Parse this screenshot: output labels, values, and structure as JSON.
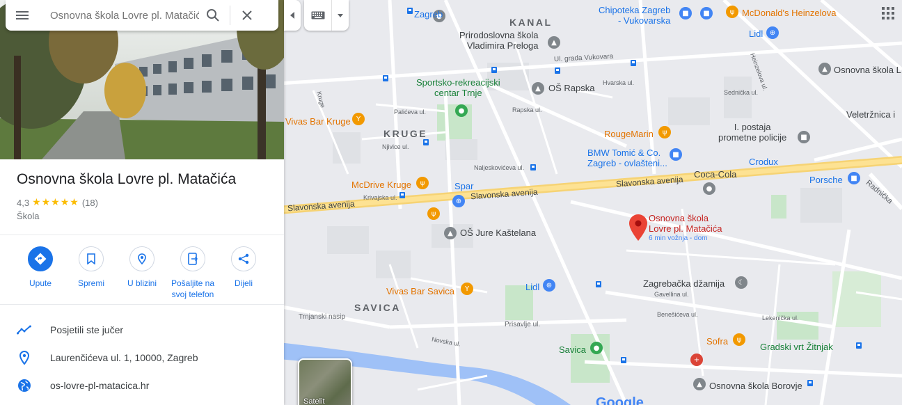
{
  "search": {
    "placeholder": "Osnovna škola Lovre pl. Matačića",
    "value": "Osnovna škola Lovre pl. Matačića"
  },
  "place": {
    "title": "Osnovna škola Lovre pl. Matačića",
    "rating": "4,3",
    "stars": "★★★★★",
    "review_count": "(18)",
    "category": "Škola"
  },
  "actions": [
    {
      "label": "Upute",
      "icon": "directions-icon"
    },
    {
      "label": "Spremi",
      "icon": "bookmark-icon"
    },
    {
      "label": "U blizini",
      "icon": "nearby-icon"
    },
    {
      "label": "Pošaljite na svoj telefon",
      "icon": "send-to-phone-icon"
    },
    {
      "label": "Dijeli",
      "icon": "share-icon"
    }
  ],
  "info": [
    {
      "text": "Posjetili ste jučer",
      "icon": "trend-icon"
    },
    {
      "text": "Laurenčićeva ul. 1, 10000, Zagreb",
      "icon": "location-pin-icon"
    },
    {
      "text": "os-lovre-pl-matacica.hr",
      "icon": "globe-icon"
    }
  ],
  "map": {
    "satellite_label": "Satelit",
    "logo": "Google",
    "marker": {
      "name_line1": "Osnovna škola",
      "name_line2": "Lovre pl. Matačića",
      "eta": "6 min vožnja - dom"
    },
    "districts": [
      "KANAL",
      "KRUGE",
      "SAVICA"
    ],
    "pois": {
      "zagreb": "Zagreb",
      "prirodoslovna1": "Prirodoslovna škola",
      "prirodoslovna2": "Vladimira Preloga",
      "sportsko1": "Sportsko-rekreacijski",
      "sportsko2": "centar Trnje",
      "os_rapska": "OŠ Rapska",
      "vivas_kruge": "Vivas Bar Kruge",
      "mcdrive": "McDrive Kruge",
      "spar": "Spar",
      "os_jure": "OŠ Jure Kaštelana",
      "vivas_savica": "Vivas Bar Savica",
      "lidl1": "Lidl",
      "lidl2": "Lidl",
      "savica": "Savica",
      "chipoteka1": "Chipoteka Zagreb",
      "chipoteka2": "- Vukovarska",
      "mcdonalds": "McDonald's Heinzelova",
      "rougemarin": "RougeMarin",
      "bmw1": "BMW Tomić & Co.",
      "bmw2": "Zagreb - ovlašteni...",
      "cocacola": "Coca-Cola",
      "crodux": "Crodux",
      "porsche": "Porsche",
      "postaja1": "I. postaja",
      "postaja2": "prometne policije",
      "veletrznica": "Veletržnica i",
      "os_lovre_right": "Osnovna škola L",
      "dzamija": "Zagrebačka džamija",
      "sofra": "Sofra",
      "gradski_vrt": "Gradski vrt Žitnjak",
      "os_borovje": "Osnovna škola Borovje"
    },
    "streets": {
      "vukovara": "Ul. grada Vukovara",
      "slavonska1": "Slavonska avenija",
      "slavonska2": "Slavonska avenija",
      "slavonska3": "Slavonska avenija",
      "trnjanski": "Trnjanski nasip",
      "prisavlje": "Prisavlje ul.",
      "radnicka": "Radnička",
      "heinzelova": "Heinzelova ul.",
      "kruge": "Kruge",
      "paliceva": "Palićeva ul.",
      "njivice": "Njivice ul.",
      "naljeskoviceva": "Naljeskovićeva ul.",
      "krivajska": "Krivajska ul.",
      "novska": "Novska ul.",
      "gavellina": "Gavellina ul.",
      "benediktova": "Benešićeva ul.",
      "lekenicka": "Lekenička ul.",
      "hvarska": "Hvarska ul.",
      "rapska": "Rapska ul.",
      "sednicka": "Sednička ul."
    }
  }
}
